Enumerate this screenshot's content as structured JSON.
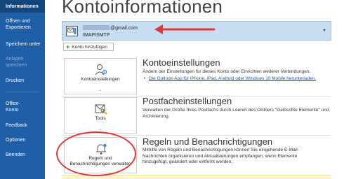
{
  "sidebar": {
    "items": [
      {
        "label": "Informationen"
      },
      {
        "label": "Öffnen und\nExportieren"
      },
      {
        "label": "Speichern unter"
      },
      {
        "label": "Anlagen\nspeichern"
      },
      {
        "label": "Drucken"
      },
      {
        "label": "Office-\nKonto"
      },
      {
        "label": "Feedback"
      },
      {
        "label": "Optionen"
      },
      {
        "label": "Beenden"
      }
    ]
  },
  "page": {
    "title": "Kontoinformationen"
  },
  "account": {
    "email_suffix": "@gmail.com",
    "type": "IMAP/SMTP",
    "dropdown_icon": "chevron-down-icon"
  },
  "add_account": {
    "label": "Konto hinzufügen"
  },
  "sections": [
    {
      "tile_label": "Kontoeinstellungen",
      "title": "Kontoeinstellungen",
      "description": "Ändern der Einstellungen für dieses Konto oder Einrichten weiterer Verbindungen.",
      "link": "Die Outlook-App für iPhone, iPad, Android oder Windows 10 Mobile herunterladen.",
      "icon": "account-settings-icon"
    },
    {
      "tile_label": "Tools",
      "title": "Postfacheinstellungen",
      "description": "Verwalten der Größe Ihres Postfachs durch Leeren des Ordners \"Gelöschte Elemente\" und Archivierung.",
      "icon": "tools-icon"
    },
    {
      "tile_label": "Regeln und\nBenachrichtigungen verwalten",
      "title": "Regeln und Benachrichtigungen",
      "description": "Mithilfe von Regeln und Benachrichtigungen können Sie eingehende E-Mail-Nachrichten organisieren und Aktualisierungen empfangen, wenn Elemente hinzugefügt, geändert oder entfernt werden.",
      "icon": "rules-alerts-icon"
    }
  ],
  "colors": {
    "sidebar_bg": "#1e5fa8",
    "sidebar_active": "#14467e",
    "account_bar_bg": "#c7ddf1",
    "annotation_red": "#dc3a3a"
  }
}
